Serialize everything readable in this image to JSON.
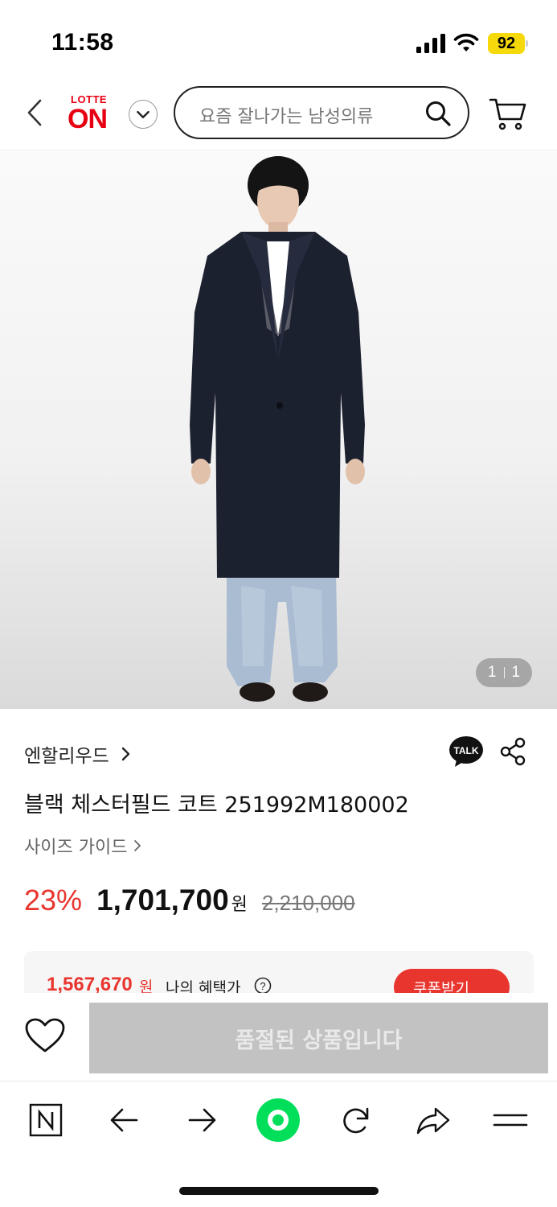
{
  "status_bar": {
    "time": "11:58",
    "battery": "92"
  },
  "header": {
    "logo_top": "LOTTE",
    "logo_main": "ON",
    "search_placeholder": "요즘 잘나가는 남성의류"
  },
  "gallery": {
    "current": "1",
    "total": "1"
  },
  "product": {
    "brand": "엔할리우드",
    "title": "블랙 체스터필드 코트 251992M180002",
    "size_guide": "사이즈 가이드",
    "discount_rate": "23%",
    "sale_price": "1,701,700",
    "currency": "원",
    "original_price": "2,210,000"
  },
  "benefit": {
    "price": "1,567,670",
    "currency": "원",
    "label": "나의 혜택가",
    "coupon_button": "쿠폰받기"
  },
  "action": {
    "soldout_label": "품절된 상품입니다"
  },
  "colors": {
    "accent_red": "#e8352e",
    "brand_red": "#e60012",
    "soldout_gray": "#c2c2c2",
    "naver_green": "#00de5a"
  },
  "icons": [
    "back-icon",
    "chevron-down-icon",
    "search-icon",
    "cart-icon",
    "chevron-right-icon",
    "kakao-talk-icon",
    "share-icon",
    "help-icon",
    "heart-icon",
    "naver-n-icon",
    "arrow-left-icon",
    "arrow-right-icon",
    "naver-green-dot-icon",
    "refresh-icon",
    "forward-share-icon",
    "menu-icon"
  ]
}
